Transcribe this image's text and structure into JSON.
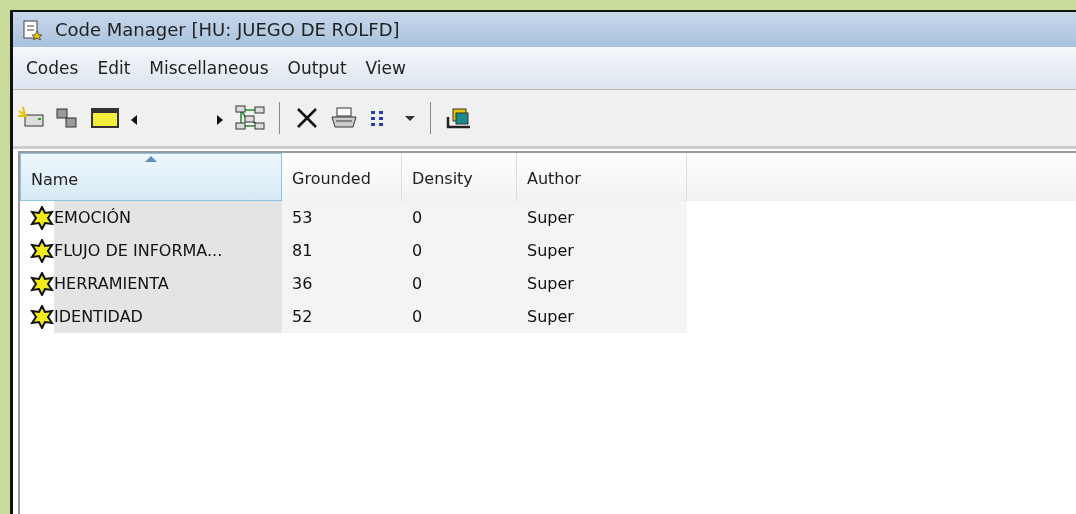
{
  "window": {
    "title": "Code Manager [HU: JUEGO DE ROLFD]"
  },
  "menu": [
    "Codes",
    "Edit",
    "Miscellaneous",
    "Output",
    "View"
  ],
  "table": {
    "columns": [
      {
        "label": "Name",
        "sorted": true
      },
      {
        "label": "Grounded",
        "sorted": false
      },
      {
        "label": "Density",
        "sorted": false
      },
      {
        "label": "Author",
        "sorted": false
      }
    ],
    "rows": [
      {
        "cells": [
          "EMOCIÓN",
          "53",
          "0",
          "Super"
        ]
      },
      {
        "cells": [
          "FLUJO DE INFORMA...",
          "81",
          "0",
          "Super"
        ]
      },
      {
        "cells": [
          "HERRAMIENTA",
          "36",
          "0",
          "Super"
        ]
      },
      {
        "cells": [
          "IDENTIDAD",
          "52",
          "0",
          "Super"
        ]
      }
    ]
  }
}
